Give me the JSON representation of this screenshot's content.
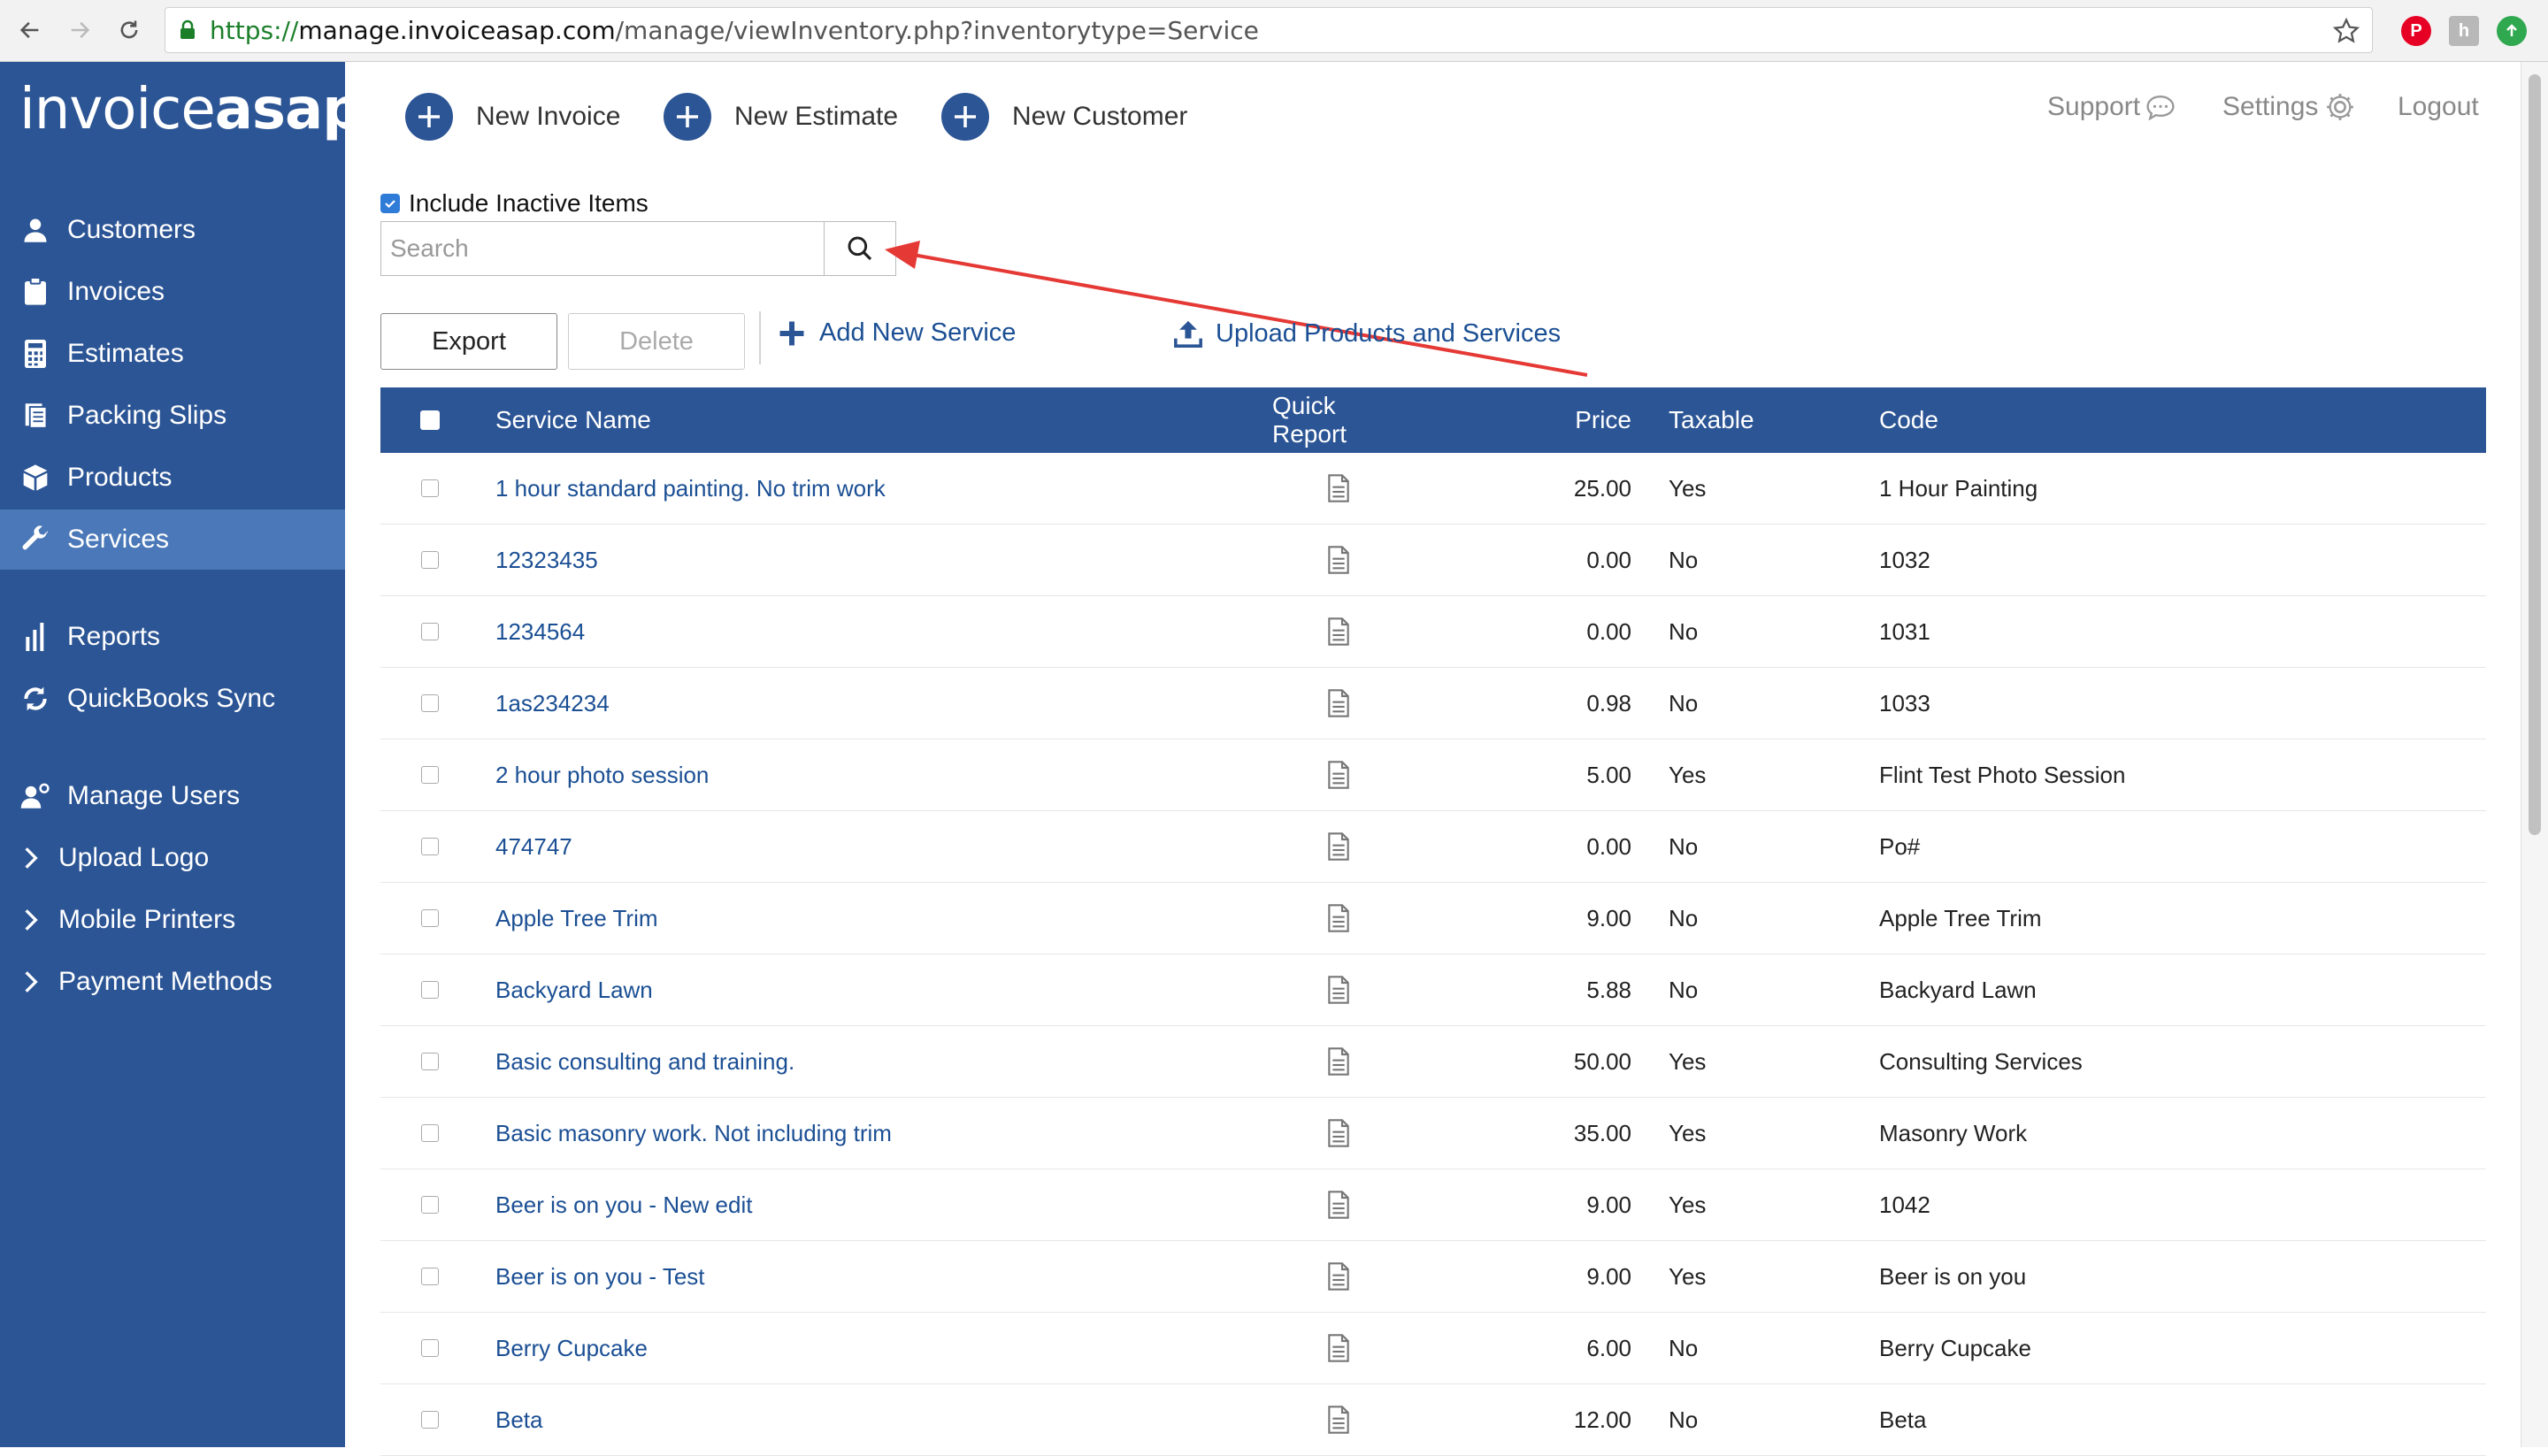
{
  "browser": {
    "url_scheme": "https://",
    "url_host": "manage.invoiceasap.com",
    "url_path": "/manage/viewInventory.php?inventorytype=Service"
  },
  "sidebar": {
    "logo_part1": "invoice",
    "logo_part2": "asap",
    "items": [
      {
        "label": "Customers",
        "icon": "user-icon"
      },
      {
        "label": "Invoices",
        "icon": "clipboard-icon"
      },
      {
        "label": "Estimates",
        "icon": "calculator-icon"
      },
      {
        "label": "Packing Slips",
        "icon": "receipt-icon"
      },
      {
        "label": "Products",
        "icon": "box-icon"
      },
      {
        "label": "Services",
        "icon": "wrench-icon"
      },
      {
        "label": "Reports",
        "icon": "bar-chart-icon"
      },
      {
        "label": "QuickBooks Sync",
        "icon": "sync-icon"
      },
      {
        "label": "Manage Users",
        "icon": "user-gear-icon"
      },
      {
        "label": "Upload Logo",
        "icon": "chevron-right-icon"
      },
      {
        "label": "Mobile Printers",
        "icon": "chevron-right-icon"
      },
      {
        "label": "Payment Methods",
        "icon": "chevron-right-icon"
      }
    ]
  },
  "topbar": {
    "new_invoice": "New Invoice",
    "new_estimate": "New Estimate",
    "new_customer": "New Customer",
    "support": "Support",
    "settings": "Settings",
    "logout": "Logout"
  },
  "filters": {
    "include_inactive_label": "Include Inactive Items",
    "include_inactive_checked": true,
    "search_placeholder": "Search"
  },
  "actions": {
    "export": "Export",
    "delete": "Delete",
    "add_new_service": "Add New Service",
    "upload": "Upload Products and Services"
  },
  "table": {
    "headers": {
      "name": "Service Name",
      "quick_report": "Quick Report",
      "price": "Price",
      "taxable": "Taxable",
      "code": "Code"
    },
    "rows": [
      {
        "name": "1 hour standard painting. No trim work",
        "price": "25.00",
        "taxable": "Yes",
        "code": "1 Hour Painting"
      },
      {
        "name": "12323435",
        "price": "0.00",
        "taxable": "No",
        "code": "1032"
      },
      {
        "name": "1234564",
        "price": "0.00",
        "taxable": "No",
        "code": "1031"
      },
      {
        "name": "1as234234",
        "price": "0.98",
        "taxable": "No",
        "code": "1033"
      },
      {
        "name": "2 hour photo session",
        "price": "5.00",
        "taxable": "Yes",
        "code": "Flint Test Photo Session"
      },
      {
        "name": "474747",
        "price": "0.00",
        "taxable": "No",
        "code": "Po#"
      },
      {
        "name": "Apple Tree Trim",
        "price": "9.00",
        "taxable": "No",
        "code": "Apple Tree Trim"
      },
      {
        "name": "Backyard Lawn",
        "price": "5.88",
        "taxable": "No",
        "code": "Backyard Lawn"
      },
      {
        "name": "Basic consulting and training.",
        "price": "50.00",
        "taxable": "Yes",
        "code": "Consulting Services"
      },
      {
        "name": "Basic masonry work. Not including trim",
        "price": "35.00",
        "taxable": "Yes",
        "code": "Masonry Work"
      },
      {
        "name": "Beer is on you - New edit",
        "price": "9.00",
        "taxable": "Yes",
        "code": "1042"
      },
      {
        "name": "Beer is on you - Test",
        "price": "9.00",
        "taxable": "Yes",
        "code": "Beer is on you"
      },
      {
        "name": "Berry Cupcake",
        "price": "6.00",
        "taxable": "No",
        "code": "Berry Cupcake"
      },
      {
        "name": "Beta",
        "price": "12.00",
        "taxable": "No",
        "code": "Beta"
      }
    ]
  },
  "colors": {
    "brand_blue": "#2c5595",
    "active_blue": "#4a78b8",
    "link_blue": "#1b4f94",
    "annotation_red": "#e53935"
  }
}
